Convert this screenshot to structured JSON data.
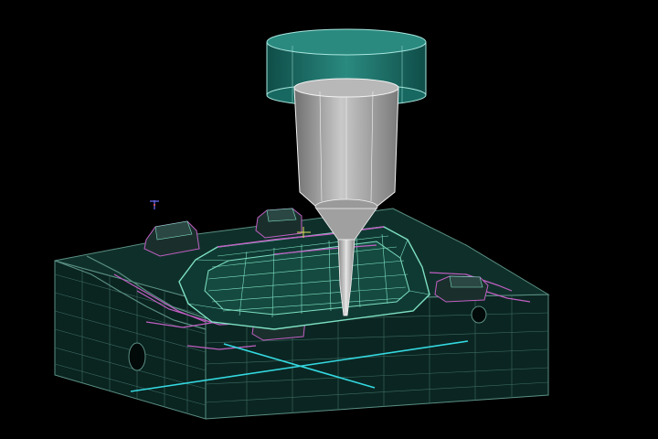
{
  "viewport": {
    "background": "#000000"
  },
  "colors": {
    "block_wire": "#5a8f83",
    "block_fill": "#0c2b26",
    "block_fill_top": "#153a33",
    "mold_feature": "#c15fc3",
    "part_wire": "#7ee0c3",
    "part_fill": "#1d5a4d",
    "spindle_fill": "#1f7a72",
    "spindle_edge": "#a7e6dd",
    "holder_fill": "#8a8a8a",
    "holder_edge": "#f2f2f2",
    "tool_fill": "#b9b9b9",
    "section_line": "#34d8e0",
    "axis_triad": "#6f6fff"
  },
  "icons": {
    "triad": "axis-triad-icon"
  }
}
